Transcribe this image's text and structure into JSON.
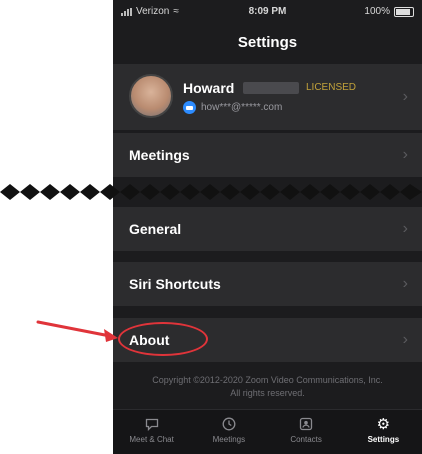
{
  "status_bar": {
    "carrier": "Verizon",
    "time": "8:09 PM",
    "battery": "100%"
  },
  "nav": {
    "title": "Settings"
  },
  "profile": {
    "name": "Howard",
    "license": "LICENSED",
    "email": "how***@*****.com"
  },
  "rows": {
    "meetings": "Meetings",
    "general": "General",
    "siri_shortcuts": "Siri Shortcuts",
    "about": "About"
  },
  "copyright": {
    "line1": "Copyright ©2012-2020 Zoom Video Communications, Inc.",
    "line2": "All rights reserved."
  },
  "tabs": [
    {
      "label": "Meet & Chat",
      "icon": "chat-bubble-icon"
    },
    {
      "label": "Meetings",
      "icon": "clock-icon"
    },
    {
      "label": "Contacts",
      "icon": "contacts-icon"
    },
    {
      "label": "Settings",
      "icon": "gear-icon",
      "active": true
    }
  ],
  "colors": {
    "background": "#1c1c1e",
    "row": "#2c2c2e",
    "license_gold": "#c2a23a",
    "zoom_blue": "#2d8cff",
    "annotation_red": "#e0343a"
  }
}
